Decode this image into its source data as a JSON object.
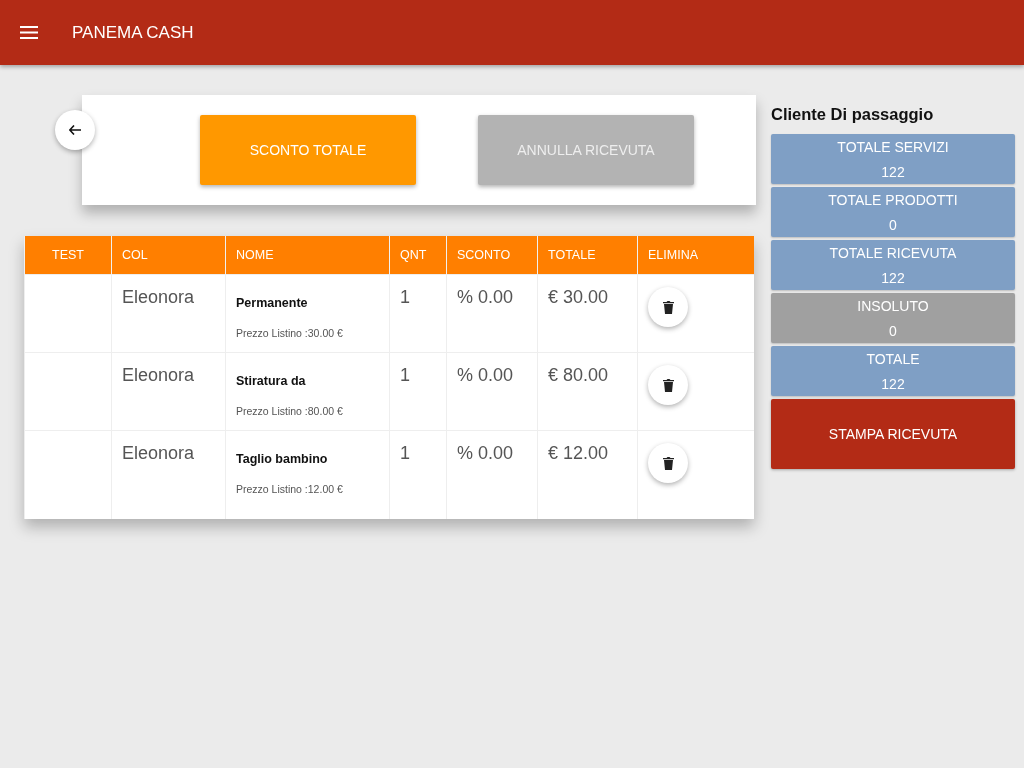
{
  "app_bar": {
    "title": "PANEMA CASH"
  },
  "actions": [
    {
      "label": "SCONTO TOTALE",
      "disabled": false
    },
    {
      "label": "ANNULLA RICEVUTA",
      "disabled": true
    }
  ],
  "table": {
    "columns": [
      "TEST",
      "COL",
      "NOME",
      "QNT",
      "SCONTO",
      "TOTALE",
      "ELIMINA"
    ],
    "rows": [
      {
        "col": "Eleonora",
        "name": "Permanente",
        "price": "Prezzo Listino :30.00 €",
        "qnt": "1",
        "sconto": "% 0.00",
        "totale": "€ 30.00"
      },
      {
        "col": "Eleonora",
        "name": "Stiratura da",
        "price": "Prezzo Listino :80.00 €",
        "qnt": "1",
        "sconto": "% 0.00",
        "totale": "€ 80.00"
      },
      {
        "col": "Eleonora",
        "name": "Taglio bambino",
        "price": "Prezzo Listino :12.00 €",
        "qnt": "1",
        "sconto": "% 0.00",
        "totale": "€ 12.00"
      }
    ]
  },
  "summary": {
    "client": "Cliente Di passaggio",
    "tiles": [
      {
        "label": "TOTALE SERVIZI",
        "value": "122",
        "color": "#7f9fc5"
      },
      {
        "label": "TOTALE PRODOTTI",
        "value": "0",
        "color": "#7f9fc5"
      },
      {
        "label": "TOTALE RICEVUTA",
        "value": "122",
        "color": "#7f9fc5"
      },
      {
        "label": "INSOLUTO",
        "value": "0",
        "color": "#a0a0a0"
      },
      {
        "label": "TOTALE",
        "value": "122",
        "color": "#7f9fc5"
      }
    ],
    "print_button": "STAMPA RICEVUTA"
  }
}
